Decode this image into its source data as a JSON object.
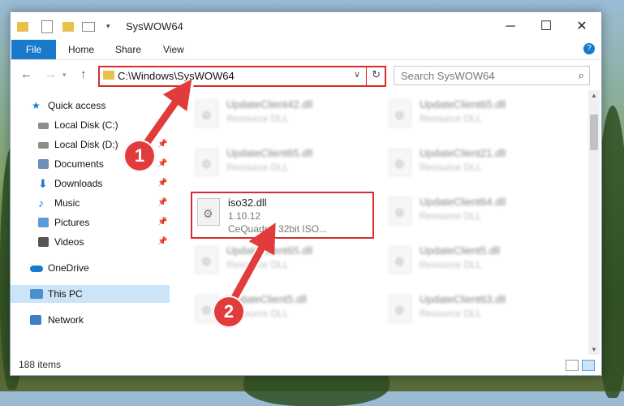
{
  "window": {
    "title": "SysWOW64",
    "minimize": "─",
    "maximize": "☐",
    "close": "✕"
  },
  "ribbon": {
    "file": "File",
    "home": "Home",
    "share": "Share",
    "view": "View",
    "help": "?"
  },
  "nav": {
    "back": "←",
    "forward": "→",
    "up": "↑",
    "address": "C:\\Windows\\SysWOW64",
    "dropdown": "∨",
    "refresh": "↻",
    "search_placeholder": "Search SysWOW64",
    "search_icon": "⌕"
  },
  "sidebar": {
    "items": [
      {
        "label": "Quick access",
        "icon": "star-icon"
      },
      {
        "label": "Local Disk (C:)",
        "icon": "drive-icon",
        "pin": "📌"
      },
      {
        "label": "Local Disk (D:)",
        "icon": "drive-icon",
        "pin": "📌"
      },
      {
        "label": "Documents",
        "icon": "documents-icon",
        "pin": "📌"
      },
      {
        "label": "Downloads",
        "icon": "downloads-icon",
        "pin": "📌"
      },
      {
        "label": "Music",
        "icon": "music-icon",
        "pin": "📌"
      },
      {
        "label": "Pictures",
        "icon": "pictures-icon",
        "pin": "📌"
      },
      {
        "label": "Videos",
        "icon": "videos-icon",
        "pin": "📌"
      },
      {
        "label": "OneDrive",
        "icon": "cloud-icon"
      },
      {
        "label": "This PC",
        "icon": "computer-icon"
      },
      {
        "label": "Network",
        "icon": "network-icon"
      }
    ]
  },
  "files": [
    {
      "name": "UpdateClient42.dll",
      "desc": "Resource DLL"
    },
    {
      "name": "UpdateClient65.dll",
      "desc": "Resource DLL"
    },
    {
      "name": "UpdateClient65.dll",
      "desc": "Resource DLL"
    },
    {
      "name": "UpdateClient21.dll",
      "desc": "Resource DLL"
    },
    {
      "name": "UpdateClient64.dll",
      "desc": "Resource DLL"
    },
    {
      "name": "UpdateClient65.dll",
      "desc": "Resource DLL"
    },
    {
      "name": "UpdateClient5.dll",
      "desc": "Resource DLL"
    },
    {
      "name": "UpdateClient5.dll",
      "desc": "Resource DLL"
    },
    {
      "name": "UpdateClient63.dll",
      "desc": "Resource DLL"
    }
  ],
  "highlighted_file": {
    "name": "iso32.dll",
    "version": "1.10.12",
    "desc": "CeQuadrat 32bit ISO..."
  },
  "status": {
    "item_count": "188 items"
  },
  "callouts": {
    "one": "1",
    "two": "2"
  },
  "colors": {
    "accent": "#1979ca",
    "highlight": "#d92c2c",
    "selected": "#cce4f7"
  }
}
